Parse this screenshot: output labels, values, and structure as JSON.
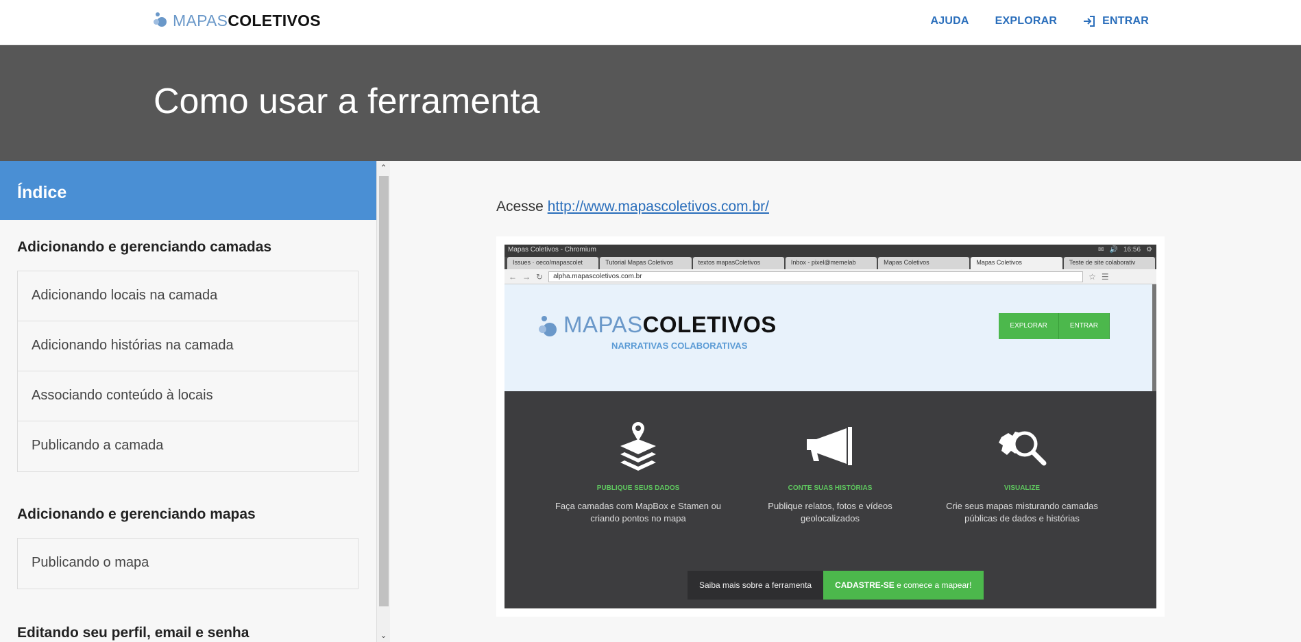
{
  "topbar": {
    "logo_light": "MAPAS",
    "logo_bold": "COLETIVOS",
    "nav": {
      "help": "AJUDA",
      "explore": "EXPLORAR",
      "enter": "ENTRAR"
    }
  },
  "hero": {
    "title": "Como usar a ferramenta"
  },
  "sidebar": {
    "title": "Índice",
    "sections": [
      {
        "title": "Adicionando e gerenciando camadas",
        "items": [
          "Adicionando locais na camada",
          "Adicionando histórias na camada",
          "Associando conteúdo à locais",
          "Publicando a camada"
        ]
      },
      {
        "title": "Adicionando e gerenciando mapas",
        "items": [
          "Publicando o mapa"
        ]
      },
      {
        "title": "Editando seu perfil, email e senha",
        "items": []
      }
    ]
  },
  "main": {
    "access_text": "Acesse",
    "access_link": "http://www.mapascoletivos.com.br/"
  },
  "screenshot": {
    "window_title": "Mapas Coletivos - Chromium",
    "clock": "16:56",
    "tabs": [
      "Issues · oeco/mapascolet",
      "Tutorial Mapas Coletivos",
      "textos mapasColetivos",
      "Inbox - pixel@memelab",
      "Mapas Coletivos",
      "Mapas Coletivos",
      "Teste de site colaborativ"
    ],
    "url": "alpha.mapascoletivos.com.br",
    "logo_light": "MAPAS",
    "logo_bold": "COLETIVOS",
    "tagline": "NARRATIVAS COLABORATIVAS",
    "btn_explore": "EXPLORAR",
    "btn_enter": "ENTRAR",
    "features": [
      {
        "title": "PUBLIQUE SEUS DADOS",
        "desc1": "Faça camadas com MapBox e Stamen ou",
        "desc2": "criando pontos no mapa"
      },
      {
        "title": "CONTE SUAS HISTÓRIAS",
        "desc1": "Publique relatos, fotos e vídeos",
        "desc2": "geolocalizados"
      },
      {
        "title": "VISUALIZE",
        "desc1": "Crie seus mapas misturando camadas",
        "desc2": "públicas de dados e histórias"
      }
    ],
    "cta_about": "Saiba mais sobre a ferramenta",
    "cta_signup_bold": "CADASTRE-SE",
    "cta_signup_rest": " e comece a mapear!"
  }
}
